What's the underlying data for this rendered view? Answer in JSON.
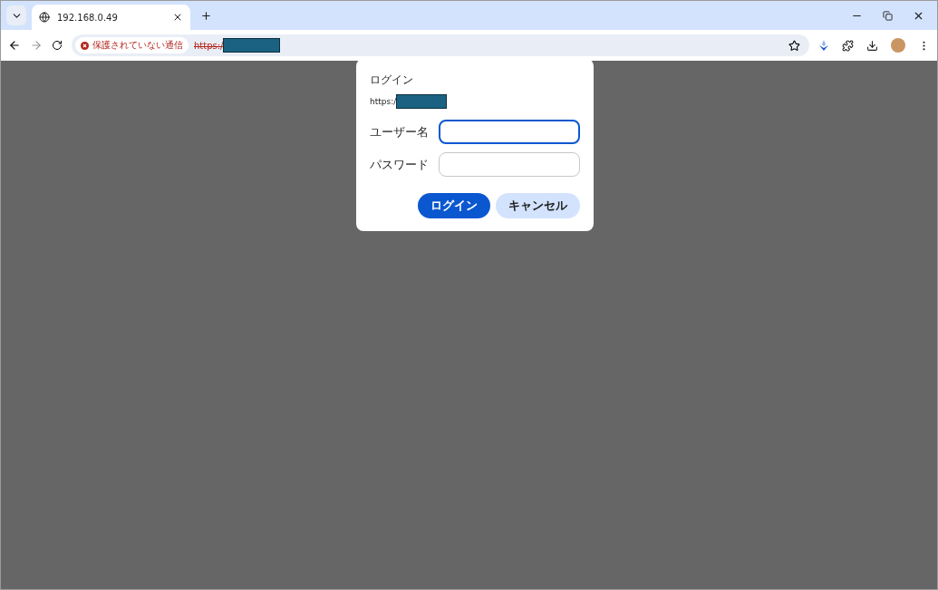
{
  "tab": {
    "title": "192.168.0.49",
    "selected": true
  },
  "address_bar": {
    "security_label": "保護されていない通信",
    "url": "https:/"
  },
  "dialog": {
    "title": "ログイン",
    "origin": "https:/",
    "fields": [
      {
        "label": "ユーザー名",
        "focused": true
      },
      {
        "label": "パスワード",
        "focused": false
      }
    ],
    "buttons": [
      {
        "label": "ログイン",
        "kind": "primary"
      },
      {
        "label": "キャンセル",
        "kind": "secondary"
      }
    ]
  }
}
